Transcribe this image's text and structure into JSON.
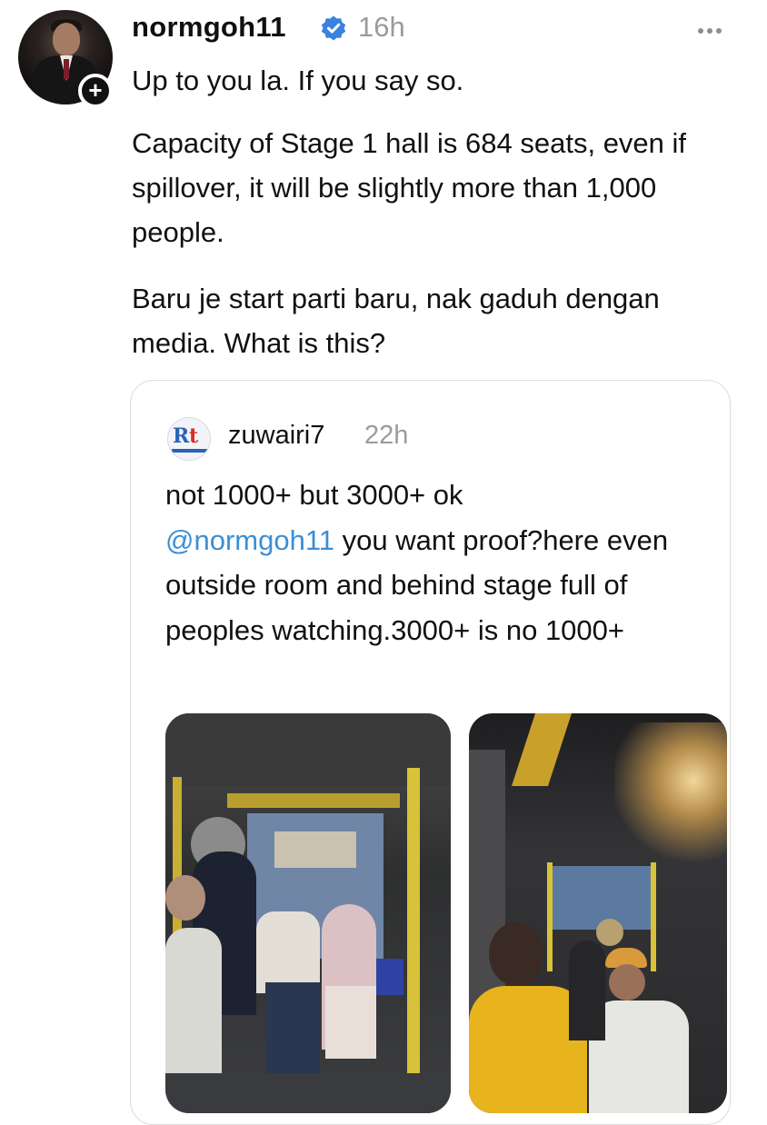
{
  "post": {
    "author": "normgoh11",
    "verified_icon": "verified-badge-icon",
    "time": "16h",
    "follow_icon": "+",
    "more_icon": "more-horizontal-icon",
    "paragraphs": [
      "Up to you la. If you say so.",
      "Capacity of Stage 1 hall is 684 seats, even if spillover, it will be slightly more than 1,000 people.",
      "Baru je start parti baru, nak gaduh dengan media. What is this?"
    ]
  },
  "quote": {
    "author": "zuwairi7",
    "time": "22h",
    "avatar_text_r": "R",
    "avatar_text_t": "t",
    "text_line1": "not 1000+ but 3000+ ok",
    "mention": "@normgoh11",
    "text_after_mention": " you want proof?here even outside room and behind stage full of peoples watching.3000+ is no 1000+",
    "photos": [
      "crowd-photo-hall-entrance",
      "crowd-photo-corridor"
    ]
  },
  "colors": {
    "verified_blue": "#3b82e0",
    "mention_blue": "#3a8fd6",
    "muted_gray": "#9b9b9b",
    "door_frame_yellow": "#d8c23a"
  }
}
